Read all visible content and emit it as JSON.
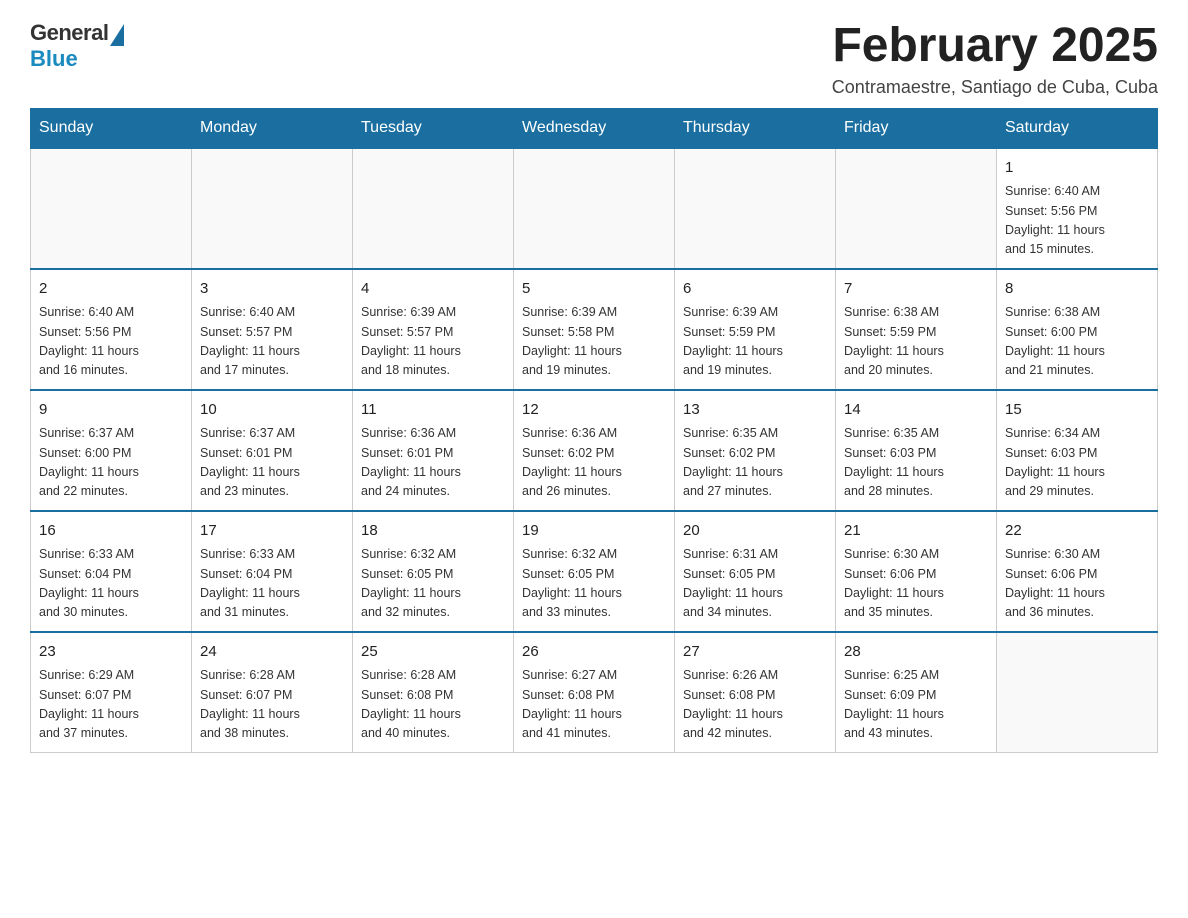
{
  "logo": {
    "general": "General",
    "blue": "Blue"
  },
  "header": {
    "title": "February 2025",
    "subtitle": "Contramaestre, Santiago de Cuba, Cuba"
  },
  "weekdays": [
    "Sunday",
    "Monday",
    "Tuesday",
    "Wednesday",
    "Thursday",
    "Friday",
    "Saturday"
  ],
  "weeks": [
    [
      {
        "day": "",
        "info": ""
      },
      {
        "day": "",
        "info": ""
      },
      {
        "day": "",
        "info": ""
      },
      {
        "day": "",
        "info": ""
      },
      {
        "day": "",
        "info": ""
      },
      {
        "day": "",
        "info": ""
      },
      {
        "day": "1",
        "info": "Sunrise: 6:40 AM\nSunset: 5:56 PM\nDaylight: 11 hours\nand 15 minutes."
      }
    ],
    [
      {
        "day": "2",
        "info": "Sunrise: 6:40 AM\nSunset: 5:56 PM\nDaylight: 11 hours\nand 16 minutes."
      },
      {
        "day": "3",
        "info": "Sunrise: 6:40 AM\nSunset: 5:57 PM\nDaylight: 11 hours\nand 17 minutes."
      },
      {
        "day": "4",
        "info": "Sunrise: 6:39 AM\nSunset: 5:57 PM\nDaylight: 11 hours\nand 18 minutes."
      },
      {
        "day": "5",
        "info": "Sunrise: 6:39 AM\nSunset: 5:58 PM\nDaylight: 11 hours\nand 19 minutes."
      },
      {
        "day": "6",
        "info": "Sunrise: 6:39 AM\nSunset: 5:59 PM\nDaylight: 11 hours\nand 19 minutes."
      },
      {
        "day": "7",
        "info": "Sunrise: 6:38 AM\nSunset: 5:59 PM\nDaylight: 11 hours\nand 20 minutes."
      },
      {
        "day": "8",
        "info": "Sunrise: 6:38 AM\nSunset: 6:00 PM\nDaylight: 11 hours\nand 21 minutes."
      }
    ],
    [
      {
        "day": "9",
        "info": "Sunrise: 6:37 AM\nSunset: 6:00 PM\nDaylight: 11 hours\nand 22 minutes."
      },
      {
        "day": "10",
        "info": "Sunrise: 6:37 AM\nSunset: 6:01 PM\nDaylight: 11 hours\nand 23 minutes."
      },
      {
        "day": "11",
        "info": "Sunrise: 6:36 AM\nSunset: 6:01 PM\nDaylight: 11 hours\nand 24 minutes."
      },
      {
        "day": "12",
        "info": "Sunrise: 6:36 AM\nSunset: 6:02 PM\nDaylight: 11 hours\nand 26 minutes."
      },
      {
        "day": "13",
        "info": "Sunrise: 6:35 AM\nSunset: 6:02 PM\nDaylight: 11 hours\nand 27 minutes."
      },
      {
        "day": "14",
        "info": "Sunrise: 6:35 AM\nSunset: 6:03 PM\nDaylight: 11 hours\nand 28 minutes."
      },
      {
        "day": "15",
        "info": "Sunrise: 6:34 AM\nSunset: 6:03 PM\nDaylight: 11 hours\nand 29 minutes."
      }
    ],
    [
      {
        "day": "16",
        "info": "Sunrise: 6:33 AM\nSunset: 6:04 PM\nDaylight: 11 hours\nand 30 minutes."
      },
      {
        "day": "17",
        "info": "Sunrise: 6:33 AM\nSunset: 6:04 PM\nDaylight: 11 hours\nand 31 minutes."
      },
      {
        "day": "18",
        "info": "Sunrise: 6:32 AM\nSunset: 6:05 PM\nDaylight: 11 hours\nand 32 minutes."
      },
      {
        "day": "19",
        "info": "Sunrise: 6:32 AM\nSunset: 6:05 PM\nDaylight: 11 hours\nand 33 minutes."
      },
      {
        "day": "20",
        "info": "Sunrise: 6:31 AM\nSunset: 6:05 PM\nDaylight: 11 hours\nand 34 minutes."
      },
      {
        "day": "21",
        "info": "Sunrise: 6:30 AM\nSunset: 6:06 PM\nDaylight: 11 hours\nand 35 minutes."
      },
      {
        "day": "22",
        "info": "Sunrise: 6:30 AM\nSunset: 6:06 PM\nDaylight: 11 hours\nand 36 minutes."
      }
    ],
    [
      {
        "day": "23",
        "info": "Sunrise: 6:29 AM\nSunset: 6:07 PM\nDaylight: 11 hours\nand 37 minutes."
      },
      {
        "day": "24",
        "info": "Sunrise: 6:28 AM\nSunset: 6:07 PM\nDaylight: 11 hours\nand 38 minutes."
      },
      {
        "day": "25",
        "info": "Sunrise: 6:28 AM\nSunset: 6:08 PM\nDaylight: 11 hours\nand 40 minutes."
      },
      {
        "day": "26",
        "info": "Sunrise: 6:27 AM\nSunset: 6:08 PM\nDaylight: 11 hours\nand 41 minutes."
      },
      {
        "day": "27",
        "info": "Sunrise: 6:26 AM\nSunset: 6:08 PM\nDaylight: 11 hours\nand 42 minutes."
      },
      {
        "day": "28",
        "info": "Sunrise: 6:25 AM\nSunset: 6:09 PM\nDaylight: 11 hours\nand 43 minutes."
      },
      {
        "day": "",
        "info": ""
      }
    ]
  ]
}
